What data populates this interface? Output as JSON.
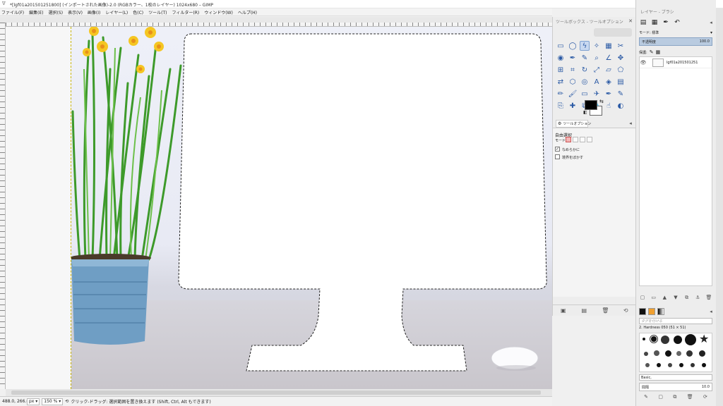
{
  "window": {
    "icon": "gimp-icon",
    "title": "*[lgf01a201501251800] (インポートされた画像)-2.0 (RGBカラー、1枚のレイヤー) 1024x680 – GIMP",
    "controls": [
      "—",
      "▢",
      "✕"
    ]
  },
  "menu": [
    "ファイル(F)",
    "編集(E)",
    "選択(S)",
    "表示(V)",
    "画像(I)",
    "レイヤー(L)",
    "色(C)",
    "ツール(T)",
    "フィルター(R)",
    "ウィンドウ(W)",
    "ヘルプ(H)"
  ],
  "toolbox": {
    "title": "ツールボックス - ツールオプション",
    "tools": [
      {
        "icon": "rect-select-icon",
        "glyph": "▭"
      },
      {
        "icon": "ellipse-select-icon",
        "glyph": "◯"
      },
      {
        "icon": "free-select-icon",
        "glyph": "ϟ"
      },
      {
        "icon": "fuzzy-select-icon",
        "glyph": "✧"
      },
      {
        "icon": "color-select-icon",
        "glyph": "▦"
      },
      {
        "icon": "scissors-icon",
        "glyph": "✂"
      },
      {
        "icon": "foreground-select-icon",
        "glyph": "◉"
      },
      {
        "icon": "paths-icon",
        "glyph": "✒"
      },
      {
        "icon": "color-picker-icon",
        "glyph": "✎"
      },
      {
        "icon": "zoom-icon",
        "glyph": "⌕"
      },
      {
        "icon": "measure-icon",
        "glyph": "∠"
      },
      {
        "icon": "move-icon",
        "glyph": "✥"
      },
      {
        "icon": "align-icon",
        "glyph": "⊞"
      },
      {
        "icon": "crop-icon",
        "glyph": "⌗"
      },
      {
        "icon": "rotate-icon",
        "glyph": "↻"
      },
      {
        "icon": "scale-icon",
        "glyph": "⤢"
      },
      {
        "icon": "shear-icon",
        "glyph": "▱"
      },
      {
        "icon": "perspective-icon",
        "glyph": "⬠"
      },
      {
        "icon": "flip-icon",
        "glyph": "⇄"
      },
      {
        "icon": "cage-icon",
        "glyph": "⬡"
      },
      {
        "icon": "warp-icon",
        "glyph": "◎"
      },
      {
        "icon": "text-icon",
        "glyph": "A"
      },
      {
        "icon": "bucket-fill-icon",
        "glyph": "◈"
      },
      {
        "icon": "gradient-icon",
        "glyph": "▤"
      },
      {
        "icon": "pencil-icon",
        "glyph": "✏"
      },
      {
        "icon": "paintbrush-icon",
        "glyph": "🖌"
      },
      {
        "icon": "eraser-icon",
        "glyph": "▭"
      },
      {
        "icon": "airbrush-icon",
        "glyph": "✈"
      },
      {
        "icon": "ink-icon",
        "glyph": "✒"
      },
      {
        "icon": "mypaint-icon",
        "glyph": "✎"
      },
      {
        "icon": "clone-icon",
        "glyph": "⎘"
      },
      {
        "icon": "heal-icon",
        "glyph": "✚"
      },
      {
        "icon": "perspective-clone-icon",
        "glyph": "⧉"
      },
      {
        "icon": "blur-icon",
        "glyph": "💧"
      },
      {
        "icon": "smudge-icon",
        "glyph": "☝"
      },
      {
        "icon": "dodge-burn-icon",
        "glyph": "◐"
      }
    ],
    "selected_tool_index": 2,
    "tab_label": "ツールオプション",
    "options": {
      "tool_name": "自由選択",
      "mode_label": "モード:",
      "antialias_label": "なめらかに",
      "antialias_checked": true,
      "feather_label": "境界をぼかす",
      "feather_checked": false
    }
  },
  "dock": {
    "title": "レイヤー - ブラシ",
    "mode_label": "モード: 標準",
    "opacity_label": "不透明度",
    "opacity_value": "100.0",
    "lock_label": "保護:",
    "layer_name": "lgf01a201501251",
    "brush_filter_placeholder": "タグを付ける",
    "brush_name": "2. Hardness 050 (51 × 51)",
    "brush_preset": "Basic,",
    "spacing_label": "間隔",
    "spacing_value": "10.0"
  },
  "status": {
    "coords": "488.0, 266.0",
    "unit": "px",
    "zoom": "150 %",
    "message": "クリック-ドラッグ: 選択範囲を置き換えます (Shift, Ctrl, Alt もできます)"
  }
}
